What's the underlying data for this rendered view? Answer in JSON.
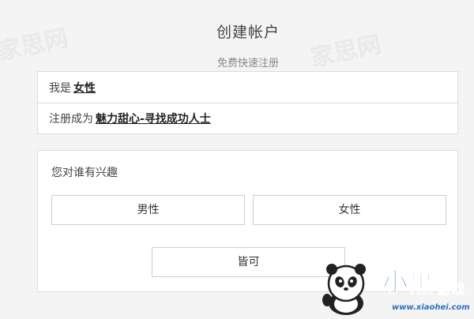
{
  "header": {
    "title": "创建帐户",
    "subtitle": "免费快速注册"
  },
  "profile": {
    "gender_prefix": "我是",
    "gender_value": "女性",
    "register_prefix": "注册成为",
    "register_value": "魅力甜心-寻找成功人士"
  },
  "interest": {
    "label": "您对谁有兴趣",
    "options": {
      "male": "男性",
      "female": "女性",
      "both": "皆可"
    }
  },
  "watermark": {
    "text": "家思网"
  },
  "logo": {
    "char1": "小",
    "char2": "黑",
    "tag": "游戏",
    "url": "www.xiaohei.com",
    "icon": "panda-icon",
    "accent_color": "#2b6fc2",
    "tag_color": "#e8403a"
  }
}
